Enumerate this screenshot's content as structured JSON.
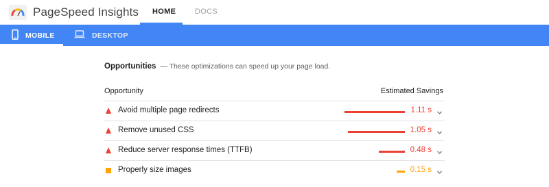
{
  "app": {
    "title": "PageSpeed Insights",
    "nav": [
      {
        "label": "HOME",
        "active": true
      },
      {
        "label": "DOCS",
        "active": false
      }
    ]
  },
  "devices": [
    {
      "label": "MOBILE",
      "active": true,
      "icon": "phone-icon"
    },
    {
      "label": "DESKTOP",
      "active": false,
      "icon": "laptop-icon"
    }
  ],
  "opportunities": {
    "title": "Opportunities",
    "description": "— These optimizations can speed up your page load.",
    "column_opportunity": "Opportunity",
    "column_savings": "Estimated Savings",
    "items": [
      {
        "title": "Avoid multiple page redirects",
        "savings": "1.11 s",
        "savings_value": 1.11,
        "severity": "fail"
      },
      {
        "title": "Remove unused CSS",
        "savings": "1.05 s",
        "savings_value": 1.05,
        "severity": "fail"
      },
      {
        "title": "Reduce server response times (TTFB)",
        "savings": "0.48 s",
        "savings_value": 0.48,
        "severity": "fail"
      },
      {
        "title": "Properly size images",
        "savings": "0.15 s",
        "savings_value": 0.15,
        "severity": "average"
      }
    ]
  },
  "colors": {
    "brand_blue": "#4285f4",
    "fail_red": "#eb4034",
    "average_orange": "#ffa400"
  }
}
